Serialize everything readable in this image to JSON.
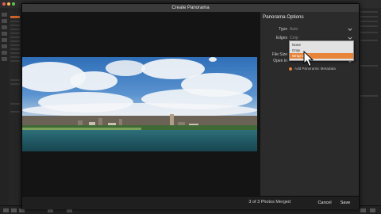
{
  "window": {
    "title": "Create Panorama"
  },
  "options": {
    "heading": "Panorama Options",
    "type": {
      "label": "Type",
      "value": "Auto"
    },
    "edges": {
      "label": "Edges",
      "value": "Crop"
    },
    "file_size": {
      "label": "File Size"
    },
    "open_in": {
      "label": "Open In"
    },
    "edges_menu": [
      {
        "label": "None",
        "selected": false
      },
      {
        "label": "Crop",
        "selected": false
      },
      {
        "label": "Wrap to fill",
        "selected": true
      }
    ],
    "add_metadata": "Add Panoramic Metadata",
    "accent_color": "#e8843a"
  },
  "footer": {
    "status": "3 of 3 Photos Merged",
    "cancel": "Cancel",
    "save": "Save"
  },
  "icons": {
    "dropdown": "chevron-down-icon",
    "pointer": "mouse-pointer-icon"
  }
}
